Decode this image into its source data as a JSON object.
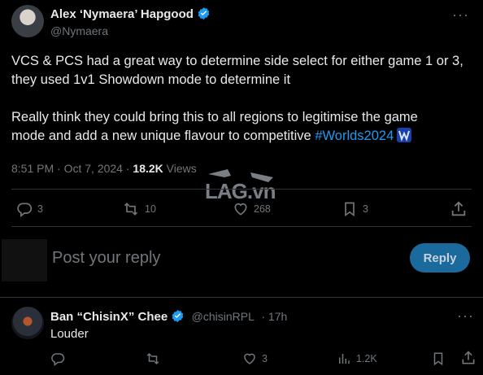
{
  "tweet": {
    "author_name": "Alex ‘Nymaera’ Hapgood",
    "author_handle": "@Nymaera",
    "more_label": "···",
    "text_line1": "VCS & PCS had a great way to determine side select for either game 1 or 3,",
    "text_line2": "they used 1v1 Showdown mode to determine it",
    "text_line3": "Really think they could bring this to all regions to legitimise the game",
    "text_line4_prefix": "mode and add a new unique flavour to competitive ",
    "hashtag": "#Worlds2024",
    "time": "8:51 PM · Oct 7, 2024 · ",
    "views_count": "18.2K",
    "views_label": " Views",
    "replies": "3",
    "retweets": "10",
    "likes": "268",
    "bookmarks": "3"
  },
  "composer": {
    "placeholder": "Post your reply",
    "button_label": "Reply"
  },
  "reply": {
    "author_name": "Ban “ChisinX” Chee",
    "author_handle": "@chisinRPL",
    "time": "· 17h",
    "more_label": "···",
    "text": "Louder",
    "replies": "",
    "retweets": "",
    "likes": "3",
    "views": "1.2K"
  },
  "watermark": {
    "text": "LAG.vn"
  },
  "colors": {
    "accent": "#1d9bf0",
    "muted": "#71767b",
    "text": "#e7e9ea",
    "divider": "#2f3336"
  }
}
